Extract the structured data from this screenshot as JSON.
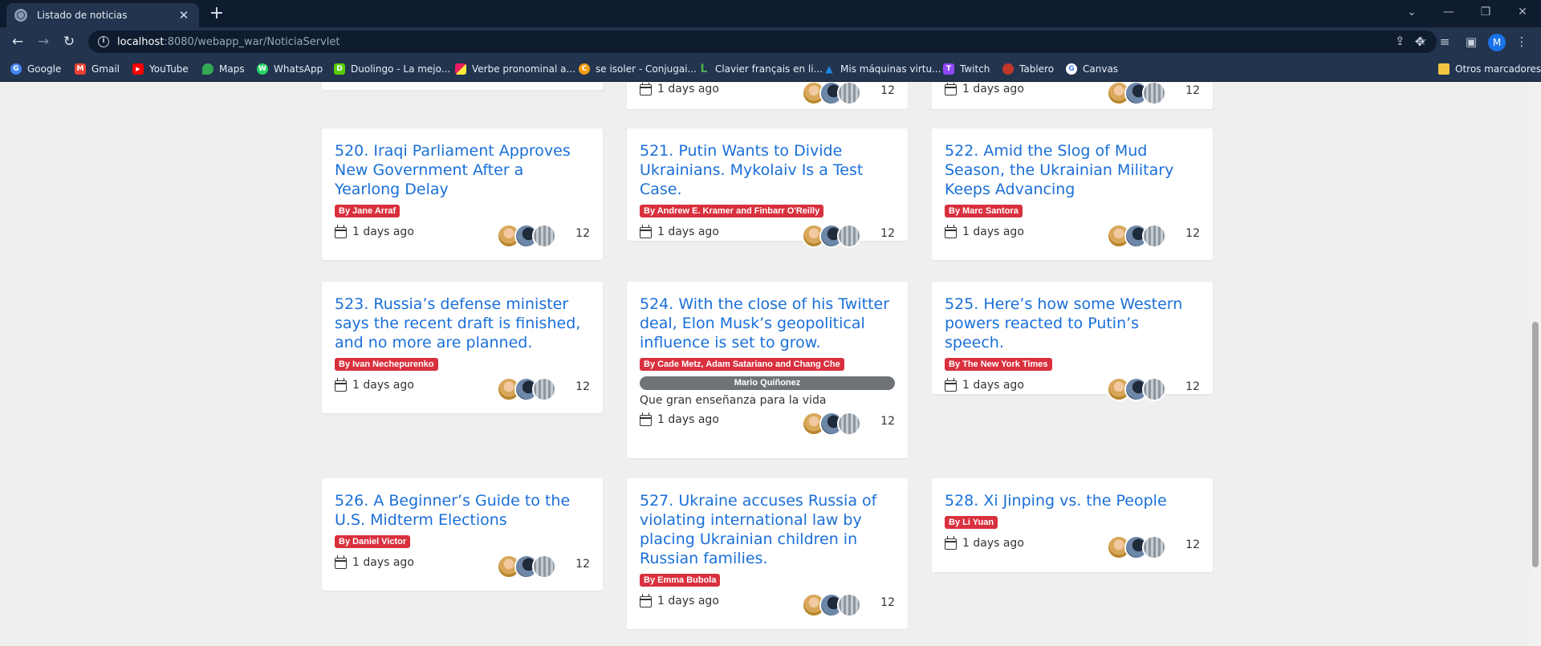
{
  "browser": {
    "tab_title": "Listado de noticias",
    "tab_close": "✕",
    "new_tab": "+",
    "url_host": "localhost",
    "url_rest": ":8080/webapp_war/NoticiaServlet",
    "profile_initial": "M"
  },
  "bookmarks": [
    {
      "label": "Google",
      "icon_color": "#4285f4",
      "glyph": "G"
    },
    {
      "label": "Gmail",
      "icon_color": "#ea4335",
      "glyph": "M"
    },
    {
      "label": "YouTube",
      "icon_color": "#ff0000",
      "glyph": "▶"
    },
    {
      "label": "Maps",
      "icon_color": "#34a853",
      "glyph": "◉"
    },
    {
      "label": "WhatsApp",
      "icon_color": "#25d366",
      "glyph": "W"
    },
    {
      "label": "Duolingo - La mejo...",
      "icon_color": "#58cc02",
      "glyph": "D"
    },
    {
      "label": "Verbe pronominal a...",
      "icon_color": "#e91e63",
      "glyph": "■"
    },
    {
      "label": "se isoler - Conjugai...",
      "icon_color": "#f39c12",
      "glyph": "C"
    },
    {
      "label": "Clavier français en li...",
      "icon_color": "#2e7d32",
      "glyph": "L"
    },
    {
      "label": "Mis máquinas virtu...",
      "icon_color": "#1976d2",
      "glyph": "▲"
    },
    {
      "label": "Twitch",
      "icon_color": "#9146ff",
      "glyph": "T"
    },
    {
      "label": "Tablero",
      "icon_color": "#e74c3c",
      "glyph": "◎"
    },
    {
      "label": "Canvas",
      "icon_color": "#ffffff",
      "glyph": "G"
    }
  ],
  "other_bookmarks": "Otros marcadores",
  "partial_top_row": {
    "date": "1 days ago",
    "count": "12"
  },
  "news": [
    {
      "title": "520. Iraqi Parliament Approves New Government After a Yearlong Delay",
      "author": "By Jane Arraf",
      "date": "1 days ago",
      "count": "12"
    },
    {
      "title": "521. Putin Wants to Divide Ukrainians. Mykolaiv Is a Test Case.",
      "author": "By Andrew E. Kramer and Finbarr O'Reilly",
      "date": "1 days ago",
      "count": "12"
    },
    {
      "title": "522. Amid the Slog of Mud Season, the Ukrainian Military Keeps Advancing",
      "author": "By Marc Santora",
      "date": "1 days ago",
      "count": "12"
    },
    {
      "title": "523. Russia’s defense minister says the recent draft is finished, and no more are planned.",
      "author": "By Ivan Nechepurenko",
      "date": "1 days ago",
      "count": "12"
    },
    {
      "title": "524. With the close of his Twitter deal, Elon Musk’s geopolitical influence is set to grow.",
      "author": "By Cade Metz, Adam Satariano and Chang Che",
      "comment_user": "Mario Quiñonez",
      "comment_text": "Que gran enseñanza para la vida",
      "date": "1 days ago",
      "count": "12"
    },
    {
      "title": "525. Here’s how some Western powers reacted to Putin’s speech.",
      "author": "By The New York Times",
      "date": "1 days ago",
      "count": "12"
    },
    {
      "title": "526. A Beginner’s Guide to the U.S. Midterm Elections",
      "author": "By Daniel Victor",
      "date": "1 days ago",
      "count": "12"
    },
    {
      "title": "527. Ukraine accuses Russia of violating international law by placing Ukrainian children in Russian families.",
      "author": "By Emma Bubola",
      "date": "1 days ago",
      "count": "12"
    },
    {
      "title": "528. Xi Jinping vs. the People",
      "author": "By Li Yuan",
      "date": "1 days ago",
      "count": "12"
    }
  ],
  "colors": {
    "title_link": "#1a6fd8",
    "author_badge": "#d9303e",
    "comment_badge": "#6f7377",
    "page_bg": "#efefef"
  }
}
